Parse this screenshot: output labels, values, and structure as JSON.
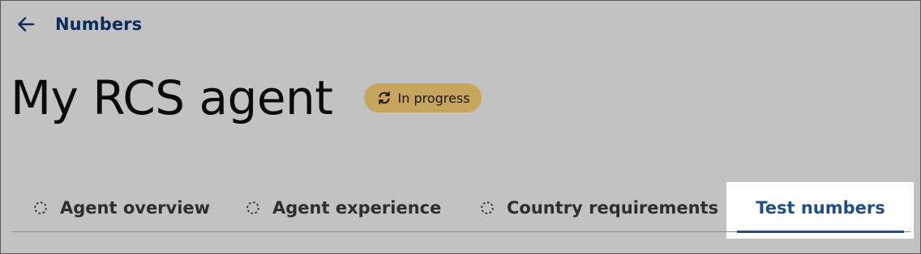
{
  "nav": {
    "back_label": "Numbers",
    "back_icon": "arrow-left-icon"
  },
  "header": {
    "title": "My RCS agent",
    "status": {
      "label": "In progress",
      "icon": "sync-icon",
      "color": "#c8a55d"
    }
  },
  "tabs": [
    {
      "label": "Agent overview",
      "icon": "pending-circle-icon",
      "active": false
    },
    {
      "label": "Agent experience",
      "icon": "pending-circle-icon",
      "active": false
    },
    {
      "label": "Country requirements",
      "icon": "pending-circle-icon",
      "active": false
    },
    {
      "label": "Test numbers",
      "active": true
    }
  ],
  "colors": {
    "background": "#c2c2c2",
    "nav_text": "#0f2b5c",
    "active_tab": "#1f4f86",
    "badge": "#c8a55d"
  }
}
